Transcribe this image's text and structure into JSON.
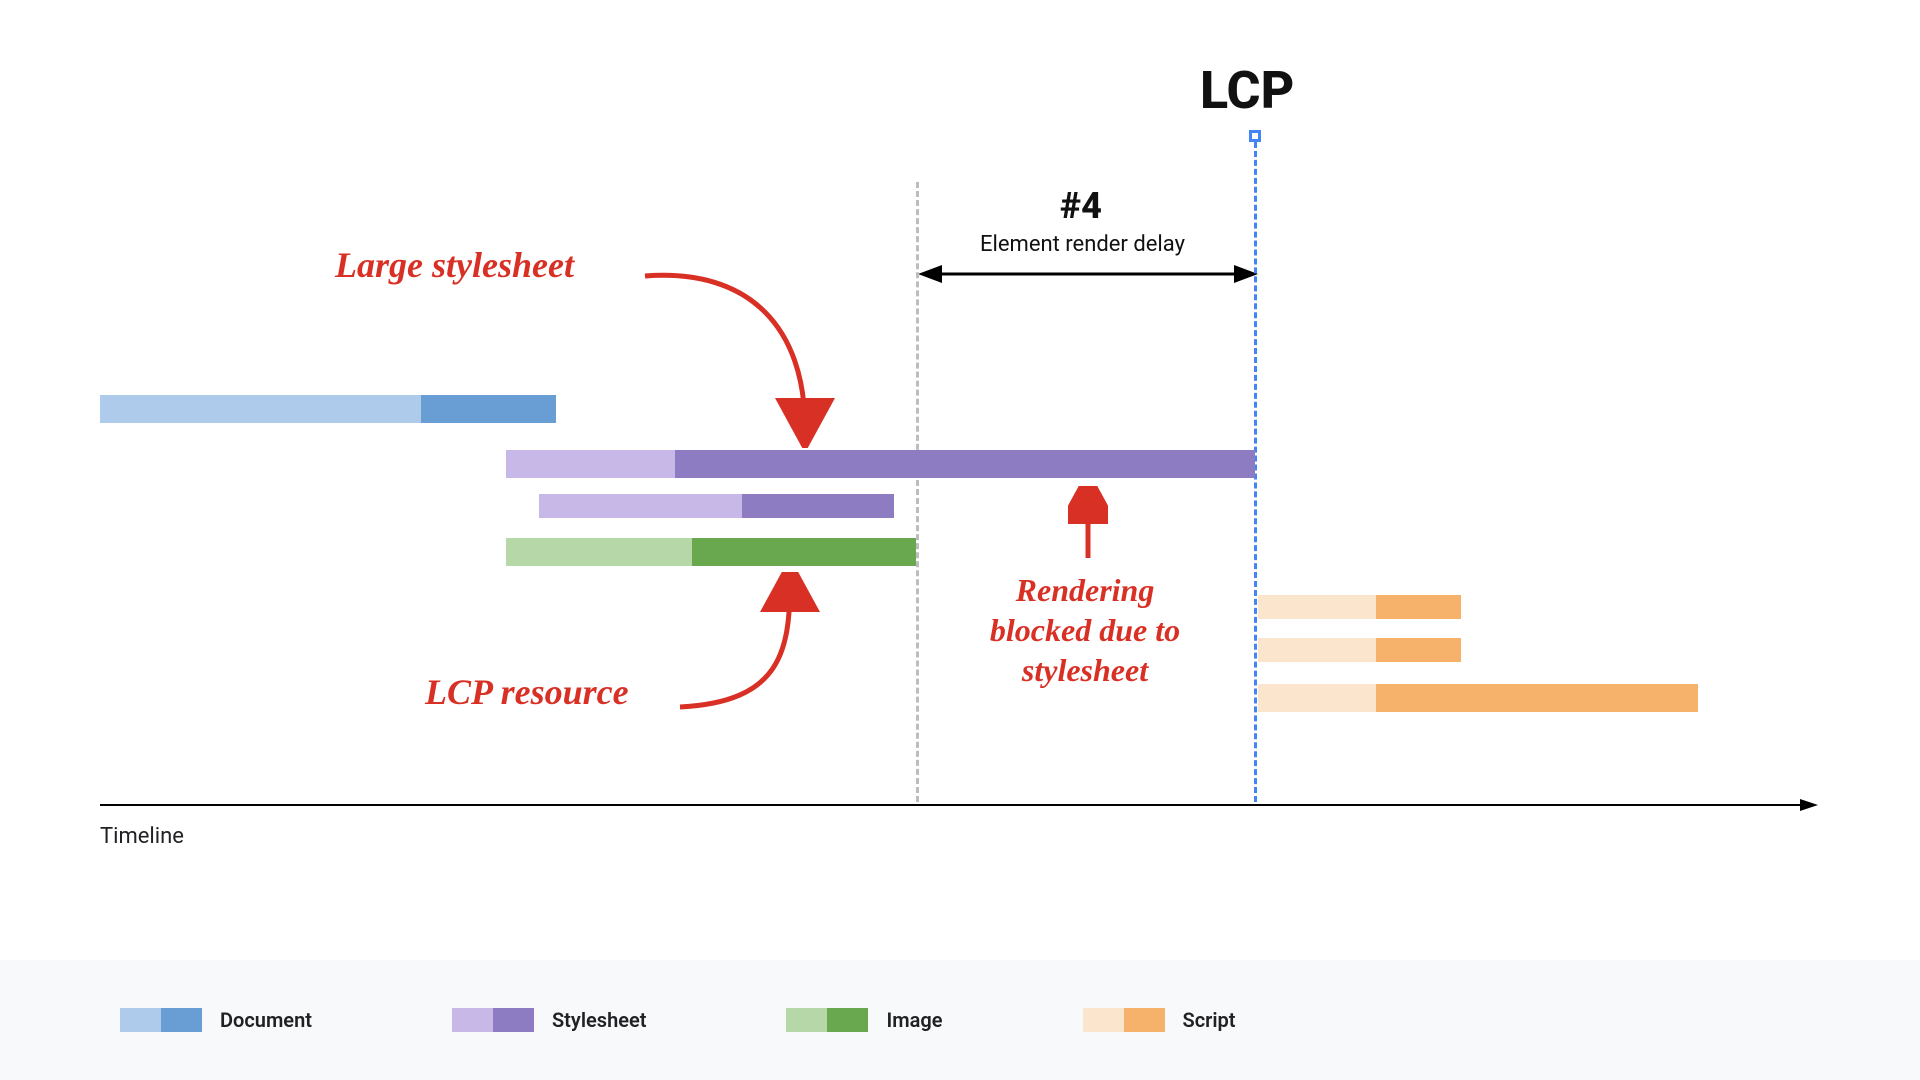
{
  "title": "LCP",
  "phase": {
    "num": "#4",
    "label": "Element render delay"
  },
  "annotations": {
    "large_stylesheet": "Large stylesheet",
    "lcp_resource": "LCP resource",
    "blocked": "Rendering\nblocked due to\nstylesheet"
  },
  "axis": {
    "label": "Timeline"
  },
  "legend": [
    {
      "label": "Document",
      "light": "#aecbeb",
      "dark": "#689ed4"
    },
    {
      "label": "Stylesheet",
      "light": "#c7b8e8",
      "dark": "#8e7cc3"
    },
    {
      "label": "Image",
      "light": "#b6d7a8",
      "dark": "#6aa84f"
    },
    {
      "label": "Script",
      "light": "#fce5cd",
      "dark": "#f6b26b"
    }
  ],
  "chart_data": {
    "type": "gantt",
    "xrange": [
      0,
      100
    ],
    "markers": {
      "render_start": 52,
      "lcp": 72
    },
    "bars": [
      {
        "name": "document",
        "row": 0,
        "start": 0,
        "split": 19,
        "end": 27,
        "kind": "document"
      },
      {
        "name": "stylesheet1",
        "row": 1,
        "start": 24,
        "split": 34,
        "end": 72,
        "kind": "stylesheet"
      },
      {
        "name": "stylesheet2",
        "row": 2,
        "start": 26,
        "split": 38,
        "end": 47,
        "kind": "stylesheet"
      },
      {
        "name": "image",
        "row": 3,
        "start": 24,
        "split": 35,
        "end": 52,
        "kind": "image"
      },
      {
        "name": "script1",
        "row": 4,
        "start": 72,
        "split": 79,
        "end": 84,
        "kind": "script"
      },
      {
        "name": "script2",
        "row": 5,
        "start": 72,
        "split": 79,
        "end": 84,
        "kind": "script"
      },
      {
        "name": "script3",
        "row": 6,
        "start": 72,
        "split": 79,
        "end": 98,
        "kind": "script"
      }
    ]
  }
}
